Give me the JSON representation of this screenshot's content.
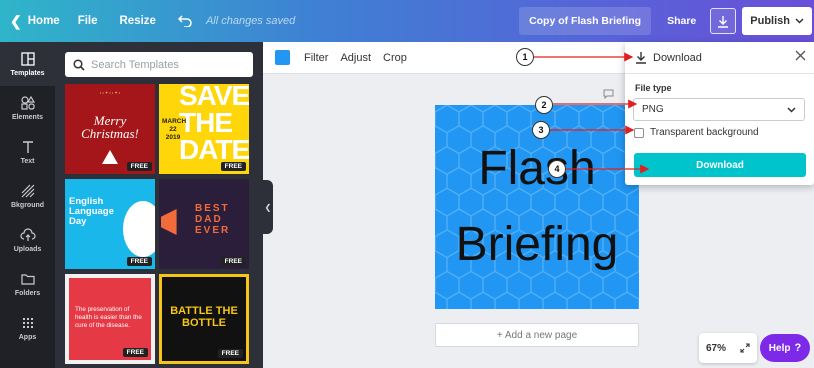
{
  "topbar": {
    "home_label": "Home",
    "file_label": "File",
    "resize_label": "Resize",
    "saved_status": "All changes saved",
    "design_title": "Copy of Flash Briefing",
    "share_label": "Share",
    "publish_label": "Publish"
  },
  "leftnav": {
    "items": [
      {
        "label": "Templates",
        "icon": "templates-icon"
      },
      {
        "label": "Elements",
        "icon": "elements-icon"
      },
      {
        "label": "Text",
        "icon": "text-icon"
      },
      {
        "label": "Bkground",
        "icon": "background-icon"
      },
      {
        "label": "Uploads",
        "icon": "uploads-icon"
      },
      {
        "label": "Folders",
        "icon": "folders-icon"
      },
      {
        "label": "Apps",
        "icon": "apps-icon"
      }
    ]
  },
  "panel": {
    "search_placeholder": "Search Templates",
    "free_badge": "FREE",
    "templates": [
      {
        "title": "Merry Christmas!",
        "bg": "#a4161a"
      },
      {
        "title": "SAVE THE DATE",
        "date": "MARCH 22 2019",
        "bg": "#ffd60a"
      },
      {
        "title": "English Language Day",
        "bg": "#1ab7ea"
      },
      {
        "title": "BEST DAD EVER",
        "bg": "#2a1e3a"
      },
      {
        "title": "The preservation of health is easier than the cure of the disease.",
        "bg": "#e63946"
      },
      {
        "title": "BATTLE THE BOTTLE",
        "bg": "#111111"
      }
    ]
  },
  "toolbar": {
    "filter_label": "Filter",
    "adjust_label": "Adjust",
    "crop_label": "Crop",
    "swatch_color": "#2196f3"
  },
  "canvas": {
    "line1": "Flash",
    "line2": "Briefing",
    "bg_color": "#2196f3",
    "add_page_label": "+ Add a new page"
  },
  "footer": {
    "zoom": "67%",
    "help_label": "Help",
    "help_glyph": "?"
  },
  "download_panel": {
    "title": "Download",
    "file_type_label": "File type",
    "file_type_value": "PNG",
    "transparent_label": "Transparent background",
    "download_button": "Download"
  },
  "annotations": [
    "1",
    "2",
    "3",
    "4"
  ],
  "colors": {
    "accent_teal": "#00c4cc",
    "help_purple": "#7d2ae8",
    "annotation_red": "#e02020"
  }
}
